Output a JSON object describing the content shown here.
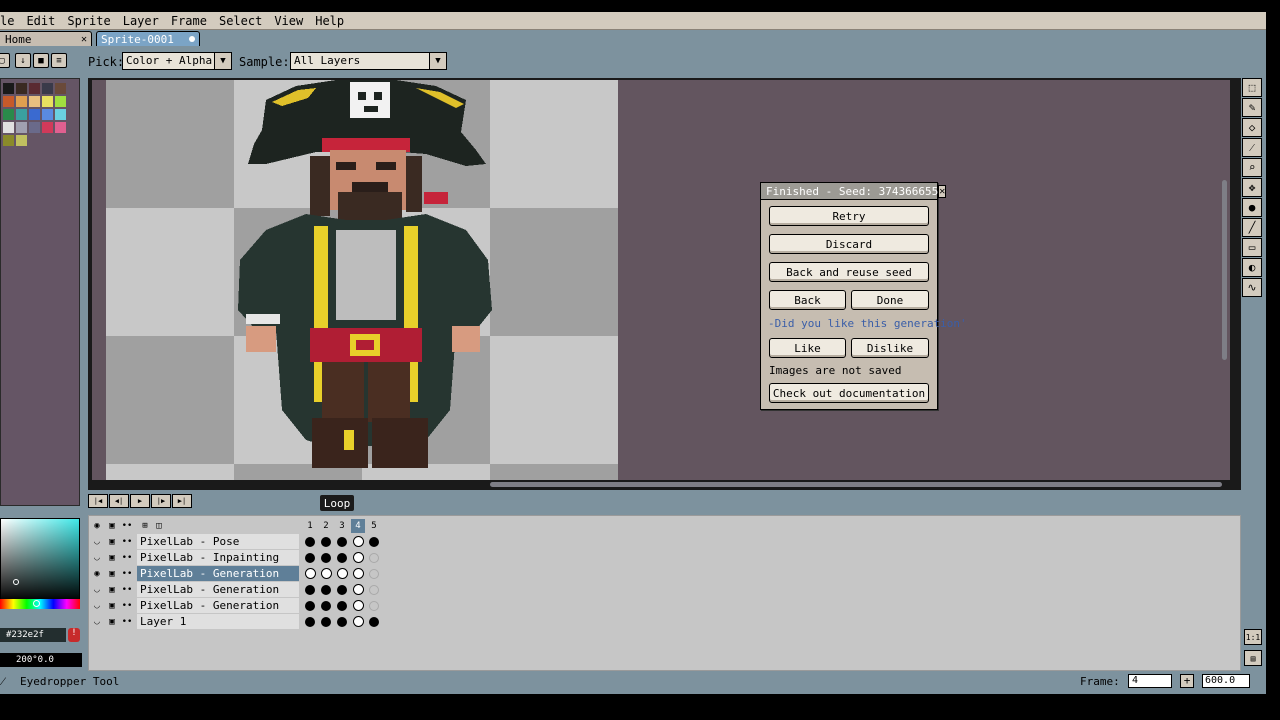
{
  "menu": [
    "le",
    "Edit",
    "Sprite",
    "Layer",
    "Frame",
    "Select",
    "View",
    "Help"
  ],
  "tabs": {
    "home": "Home",
    "sprite": "Sprite-0001"
  },
  "toolbar": {
    "pick_label": "Pick:",
    "pick_value": "Color + Alpha",
    "sample_label": "Sample:",
    "sample_value": "All Layers"
  },
  "dialog": {
    "title": "Finished - Seed: 374366655",
    "retry": "Retry",
    "discard": "Discard",
    "back_reuse": "Back and reuse seed",
    "back": "Back",
    "done": "Done",
    "question": "-Did you like this generation'",
    "like": "Like",
    "dislike": "Dislike",
    "note": "Images are not saved",
    "docs": "Check out documentation"
  },
  "timeline": {
    "loop_tag": "Loop",
    "frames": [
      "1",
      "2",
      "3",
      "4",
      "5"
    ],
    "layers": [
      {
        "name": "PixelLab - Pose",
        "cels": [
          "f",
          "f",
          "f",
          "c",
          "f"
        ]
      },
      {
        "name": "PixelLab - Inpainting",
        "cels": [
          "f",
          "f",
          "f",
          "c",
          "e"
        ]
      },
      {
        "name": "PixelLab - Generation",
        "cels": [
          "c",
          "c",
          "c",
          "c",
          "e"
        ]
      },
      {
        "name": "PixelLab - Generation",
        "cels": [
          "f",
          "f",
          "f",
          "c",
          "e"
        ]
      },
      {
        "name": "PixelLab - Generation",
        "cels": [
          "f",
          "f",
          "f",
          "c",
          "e"
        ]
      },
      {
        "name": "Layer 1",
        "cels": [
          "f",
          "f",
          "f",
          "c",
          "f"
        ]
      }
    ]
  },
  "color": {
    "hex": "#232e2f",
    "value": "200°0.0"
  },
  "status": {
    "tool": "Eyedropper Tool",
    "frame_label": "Frame:",
    "frame_value": "4",
    "zoom": "600.0"
  },
  "colors": {
    "accent": "#7ba4c6",
    "canvas_bg": "#63555f",
    "panel": "#7d929e",
    "dialog": "#c6bdb1"
  }
}
